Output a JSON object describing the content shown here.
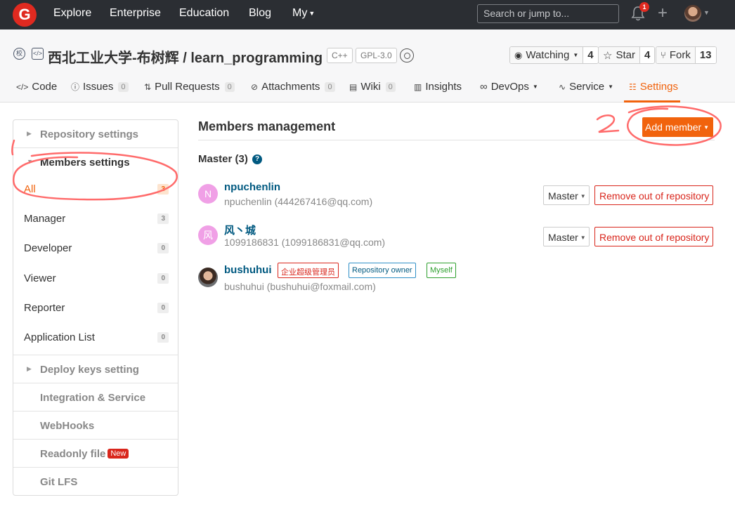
{
  "topnav": {
    "logo": "G",
    "links": [
      "Explore",
      "Enterprise",
      "Education",
      "Blog"
    ],
    "my_label": "My",
    "search_placeholder": "Search or jump to...",
    "notification_count": "1",
    "plus": "+"
  },
  "repo": {
    "title": "西北工业大学-布树辉 / learn_programming",
    "lang_tag": "C++",
    "license_tag": "GPL-3.0",
    "watching_label": "Watching",
    "watching_count": "4",
    "star_label": "Star",
    "star_count": "4",
    "fork_label": "Fork",
    "fork_count": "13"
  },
  "tabs": {
    "code": "Code",
    "issues": "Issues",
    "issues_count": "0",
    "pulls": "Pull Requests",
    "pulls_count": "0",
    "attachments": "Attachments",
    "attachments_count": "0",
    "wiki": "Wiki",
    "wiki_count": "0",
    "insights": "Insights",
    "devops": "DevOps",
    "service": "Service",
    "settings": "Settings"
  },
  "sidebar": {
    "repository_settings": "Repository settings",
    "members_settings": "Members settings",
    "items": [
      {
        "label": "All",
        "count": "3"
      },
      {
        "label": "Manager",
        "count": "3"
      },
      {
        "label": "Developer",
        "count": "0"
      },
      {
        "label": "Viewer",
        "count": "0"
      },
      {
        "label": "Reporter",
        "count": "0"
      },
      {
        "label": "Application List",
        "count": "0"
      }
    ],
    "deploy_keys": "Deploy keys setting",
    "integration": "Integration & Service",
    "webhooks": "WebHooks",
    "readonly": "Readonly file",
    "new_badge": "New",
    "git_lfs": "Git LFS"
  },
  "main": {
    "title": "Members management",
    "add_member": "Add member",
    "group_title": "Master (3)",
    "help": "?",
    "members": [
      {
        "initial": "N",
        "name": "npuchenlin",
        "detail": "npuchenlin (444267416@qq.com)",
        "role": "Master",
        "remove": "Remove out of repository"
      },
      {
        "initial": "风",
        "name": "风丶城",
        "detail": "1099186831 (1099186831@qq.com)",
        "role": "Master",
        "remove": "Remove out of repository"
      },
      {
        "name": "bushuhui",
        "detail": "bushuhui (bushuhui@foxmail.com)",
        "tags": [
          "企业超级管理员",
          "Repository owner",
          "Myself"
        ]
      }
    ]
  },
  "annotations": {
    "number_1": "1",
    "number_2": "2"
  },
  "colors": {
    "accent": "#f1630d",
    "nav_bg": "#2b2e33",
    "link": "#005980",
    "danger": "#d9261c",
    "annotation": "#ff6b6b"
  }
}
